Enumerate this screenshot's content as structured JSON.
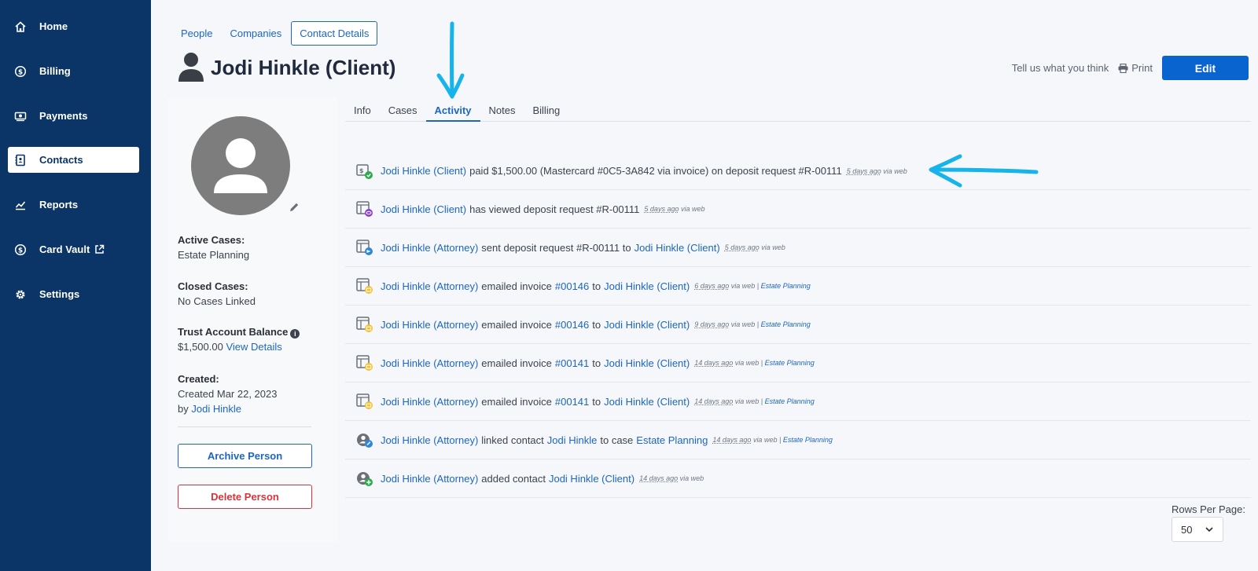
{
  "sidebar": {
    "items": [
      {
        "label": "Home",
        "icon": "home-icon"
      },
      {
        "label": "Billing",
        "icon": "dollar-circle-icon"
      },
      {
        "label": "Payments",
        "icon": "cash-icon"
      },
      {
        "label": "Contacts",
        "icon": "contact-book-icon",
        "active": true
      },
      {
        "label": "Reports",
        "icon": "chart-icon"
      },
      {
        "label": "Card Vault",
        "icon": "dollar-circle-icon"
      },
      {
        "label": "Settings",
        "icon": "gear-icon"
      }
    ]
  },
  "breadcrumbs": [
    "People",
    "Companies",
    "Contact Details"
  ],
  "page_title": "Jodi Hinkle (Client)",
  "header": {
    "feedback": "Tell us what you think",
    "print": "Print",
    "edit": "Edit"
  },
  "profile": {
    "active_cases_label": "Active Cases:",
    "active_cases_value": "Estate Planning",
    "closed_cases_label": "Closed Cases:",
    "closed_cases_value": "No Cases Linked",
    "trust_label": "Trust Account Balance",
    "trust_value": "$1,500.00",
    "trust_link": "View Details",
    "created_label": "Created:",
    "created_value": "Created Mar 22, 2023",
    "created_by_prefix": "by",
    "created_by": "Jodi Hinkle",
    "archive_button": "Archive Person",
    "delete_button": "Delete Person"
  },
  "tabs": [
    "Info",
    "Cases",
    "Activity",
    "Notes",
    "Billing"
  ],
  "active_tab": "Activity",
  "activity": [
    {
      "icon": "payment-received-icon",
      "parts": [
        {
          "t": "Jodi Hinkle (Client)",
          "link": true
        },
        {
          "t": "paid $1,500.00 (Mastercard #0C5-3A842 via invoice) on deposit request #R-00111"
        }
      ],
      "ago": "5 days ago",
      "via": "via web",
      "case": ""
    },
    {
      "icon": "invoice-viewed-icon",
      "parts": [
        {
          "t": "Jodi Hinkle (Client)",
          "link": true
        },
        {
          "t": "has viewed deposit request #R-00111"
        }
      ],
      "ago": "5 days ago",
      "via": "via web",
      "case": ""
    },
    {
      "icon": "invoice-sent-icon",
      "parts": [
        {
          "t": "Jodi Hinkle (Attorney)",
          "link": true
        },
        {
          "t": "sent deposit request #R-00111 to"
        },
        {
          "t": "Jodi Hinkle (Client)",
          "link": true
        }
      ],
      "ago": "5 days ago",
      "via": "via web",
      "case": ""
    },
    {
      "icon": "invoice-emailed-icon",
      "parts": [
        {
          "t": "Jodi Hinkle (Attorney)",
          "link": true
        },
        {
          "t": "emailed invoice"
        },
        {
          "t": "#00146",
          "link": true
        },
        {
          "t": "to"
        },
        {
          "t": "Jodi Hinkle (Client)",
          "link": true
        }
      ],
      "ago": "6 days ago",
      "via": "via web |",
      "case": "Estate Planning"
    },
    {
      "icon": "invoice-emailed-icon",
      "parts": [
        {
          "t": "Jodi Hinkle (Attorney)",
          "link": true
        },
        {
          "t": "emailed invoice"
        },
        {
          "t": "#00146",
          "link": true
        },
        {
          "t": "to"
        },
        {
          "t": "Jodi Hinkle (Client)",
          "link": true
        }
      ],
      "ago": "9 days ago",
      "via": "via web |",
      "case": "Estate Planning"
    },
    {
      "icon": "invoice-emailed-icon",
      "parts": [
        {
          "t": "Jodi Hinkle (Attorney)",
          "link": true
        },
        {
          "t": "emailed invoice"
        },
        {
          "t": "#00141",
          "link": true
        },
        {
          "t": "to"
        },
        {
          "t": "Jodi Hinkle (Client)",
          "link": true
        }
      ],
      "ago": "14 days ago",
      "via": "via web |",
      "case": "Estate Planning"
    },
    {
      "icon": "invoice-emailed-icon",
      "parts": [
        {
          "t": "Jodi Hinkle (Attorney)",
          "link": true
        },
        {
          "t": "emailed invoice"
        },
        {
          "t": "#00141",
          "link": true
        },
        {
          "t": "to"
        },
        {
          "t": "Jodi Hinkle (Client)",
          "link": true
        }
      ],
      "ago": "14 days ago",
      "via": "via web |",
      "case": "Estate Planning"
    },
    {
      "icon": "contact-linked-icon",
      "parts": [
        {
          "t": "Jodi Hinkle (Attorney)",
          "link": true
        },
        {
          "t": "linked contact"
        },
        {
          "t": "Jodi Hinkle",
          "link": true
        },
        {
          "t": "to case"
        },
        {
          "t": "Estate Planning",
          "link": true
        }
      ],
      "ago": "14 days ago",
      "via": "via web |",
      "case": "Estate Planning"
    },
    {
      "icon": "contact-added-icon",
      "parts": [
        {
          "t": "Jodi Hinkle (Attorney)",
          "link": true
        },
        {
          "t": "added contact"
        },
        {
          "t": "Jodi Hinkle (Client)",
          "link": true
        }
      ],
      "ago": "14 days ago",
      "via": "via web",
      "case": ""
    }
  ],
  "pagination": {
    "rows_label": "Rows Per Page:",
    "rows_value": "50"
  },
  "colors": {
    "sidebar": "#0b3566",
    "accent": "#1d66c0",
    "edit_button": "#0a64d0",
    "delete": "#d8323b",
    "annotation": "#17b4ec"
  }
}
